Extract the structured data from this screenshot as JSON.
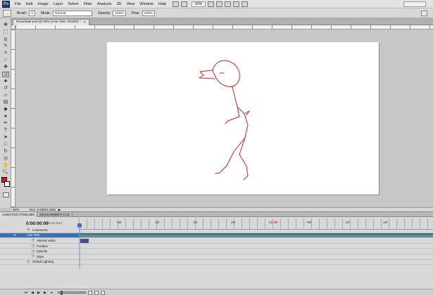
{
  "app": {
    "logo_text": "Ps"
  },
  "menu": [
    "File",
    "Edit",
    "Image",
    "Layer",
    "Select",
    "Filter",
    "Analysis",
    "3D",
    "View",
    "Window",
    "Help"
  ],
  "menubar": {
    "zoom": "50%"
  },
  "options": {
    "brush_label": "Brush:",
    "brush_size": "1",
    "mode_label": "Mode:",
    "mode_value": "Normal",
    "opacity_label": "Opacity:",
    "opacity_value": "100%",
    "flow_label": "Flow:",
    "flow_value": "100%"
  },
  "document": {
    "tab_title": "Ricardular.psd @ 50% (Line Test, RGB/8) *",
    "close_glyph": "×"
  },
  "status": {
    "zoom": "50%",
    "doc": "Doc: 5.93M/1.92M"
  },
  "animation": {
    "tabs": [
      "ANIMATION (TIMELINE)",
      "MEASUREMENT LOG"
    ],
    "timecode": "0:00:00:00",
    "fps": "(25.00 fps)",
    "ruler_labels": [
      {
        "t": "05f",
        "red": false
      },
      {
        "t": "10f",
        "red": false
      },
      {
        "t": "15f",
        "red": false
      },
      {
        "t": "20f",
        "red": false
      },
      {
        "t": "01:00f",
        "red": true
      },
      {
        "t": "05f",
        "red": false
      },
      {
        "t": "10f",
        "red": false
      },
      {
        "t": "15f",
        "red": false
      }
    ],
    "rows": [
      {
        "label": "Comments",
        "level": 1,
        "selected": false,
        "eye": false,
        "track": false,
        "keyframe": false
      },
      {
        "label": "Line Test",
        "level": 0,
        "selected": true,
        "eye": true,
        "track": true,
        "keyframe": false
      },
      {
        "label": "Altered Video",
        "level": 2,
        "selected": false,
        "eye": false,
        "track": false,
        "keyframe": true
      },
      {
        "label": "Position",
        "level": 2,
        "selected": false,
        "eye": false,
        "track": false,
        "keyframe": false
      },
      {
        "label": "Opacity",
        "level": 2,
        "selected": false,
        "eye": false,
        "track": false,
        "keyframe": false
      },
      {
        "label": "Style",
        "level": 2,
        "selected": false,
        "eye": false,
        "track": false,
        "keyframe": false
      },
      {
        "label": "Global Lighting",
        "level": 1,
        "selected": false,
        "eye": false,
        "track": false,
        "keyframe": false
      }
    ]
  },
  "tools": [
    "move",
    "marquee",
    "lasso",
    "quick-select",
    "crop",
    "eyedropper",
    "heal",
    "brush",
    "clone",
    "history",
    "eraser",
    "gradient",
    "blur",
    "dodge",
    "pen",
    "type",
    "path-select",
    "shape",
    "3d-rotate",
    "3d-orbit",
    "hand",
    "zoom"
  ],
  "colors": {
    "foreground": "#e11111",
    "background": "#ffffff",
    "stroke": "#d42020"
  }
}
